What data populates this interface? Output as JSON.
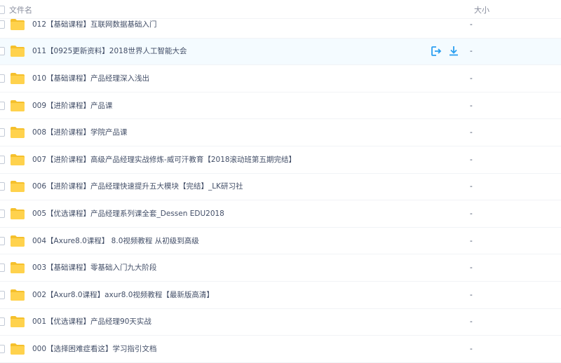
{
  "header": {
    "name_label": "文件名",
    "size_label": "大小"
  },
  "files": [
    {
      "name": "012【基础课程】互联网数据基础入门",
      "size": "-"
    },
    {
      "name": "011【0925更新资料】2018世界人工智能大会",
      "size": "-"
    },
    {
      "name": "010【基础课程】产品经理深入浅出",
      "size": "-"
    },
    {
      "name": "009【进阶课程】产品课",
      "size": "-"
    },
    {
      "name": "008【进阶课程】学院产品课",
      "size": "-"
    },
    {
      "name": "007【进阶课程】高级产品经理实战修炼-威可汗教育【2018滚动班第五期完结】",
      "size": "-"
    },
    {
      "name": "006【进阶课程】产品经理快速提升五大模块【完结】_LK研习社",
      "size": "-"
    },
    {
      "name": "005【优选课程】产品经理系列课全套_Dessen EDU2018",
      "size": "-"
    },
    {
      "name": "004【Axure8.0课程】 8.0视频教程 从初级到高级",
      "size": "-"
    },
    {
      "name": "003【基础课程】零基础入门九大阶段",
      "size": "-"
    },
    {
      "name": "002【Axur8.0课程】axur8.0视频教程【最新版高清】",
      "size": "-"
    },
    {
      "name": "001【优选课程】产品经理90天实战",
      "size": "-"
    },
    {
      "name": "000【选择困难症看这】学习指引文档",
      "size": "-"
    }
  ],
  "hover_row_index": 1,
  "row_actions": [
    "share-icon",
    "download-icon"
  ],
  "colors": {
    "folder": "#ffd24d",
    "folder_dark": "#f5c02c",
    "accent": "#2b9ff0",
    "hover_bg": "#f4fbff"
  }
}
